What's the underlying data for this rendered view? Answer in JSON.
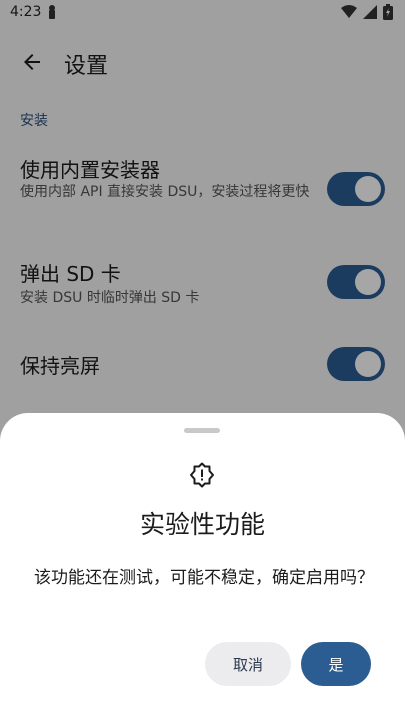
{
  "status_bar": {
    "time": "4:23"
  },
  "app_bar": {
    "title": "设置"
  },
  "section": {
    "label": "安装"
  },
  "settings": [
    {
      "title": "使用内置安装器",
      "subtitle": "使用内部 API 直接安装 DSU，安装过程将更快",
      "enabled": true
    },
    {
      "title": "弹出 SD 卡",
      "subtitle": "安装 DSU 时临时弹出 SD 卡",
      "enabled": true
    },
    {
      "title": "保持亮屏",
      "subtitle": "",
      "enabled": true
    }
  ],
  "dialog": {
    "icon": "warning-gear-icon",
    "title": "实验性功能",
    "message": "该功能还在测试，可能不稳定，确定启用吗？",
    "cancel_label": "取消",
    "confirm_label": "是"
  },
  "colors": {
    "accent": "#2b5d92",
    "sheet_bg": "#ffffff",
    "scrim": "#000000"
  }
}
